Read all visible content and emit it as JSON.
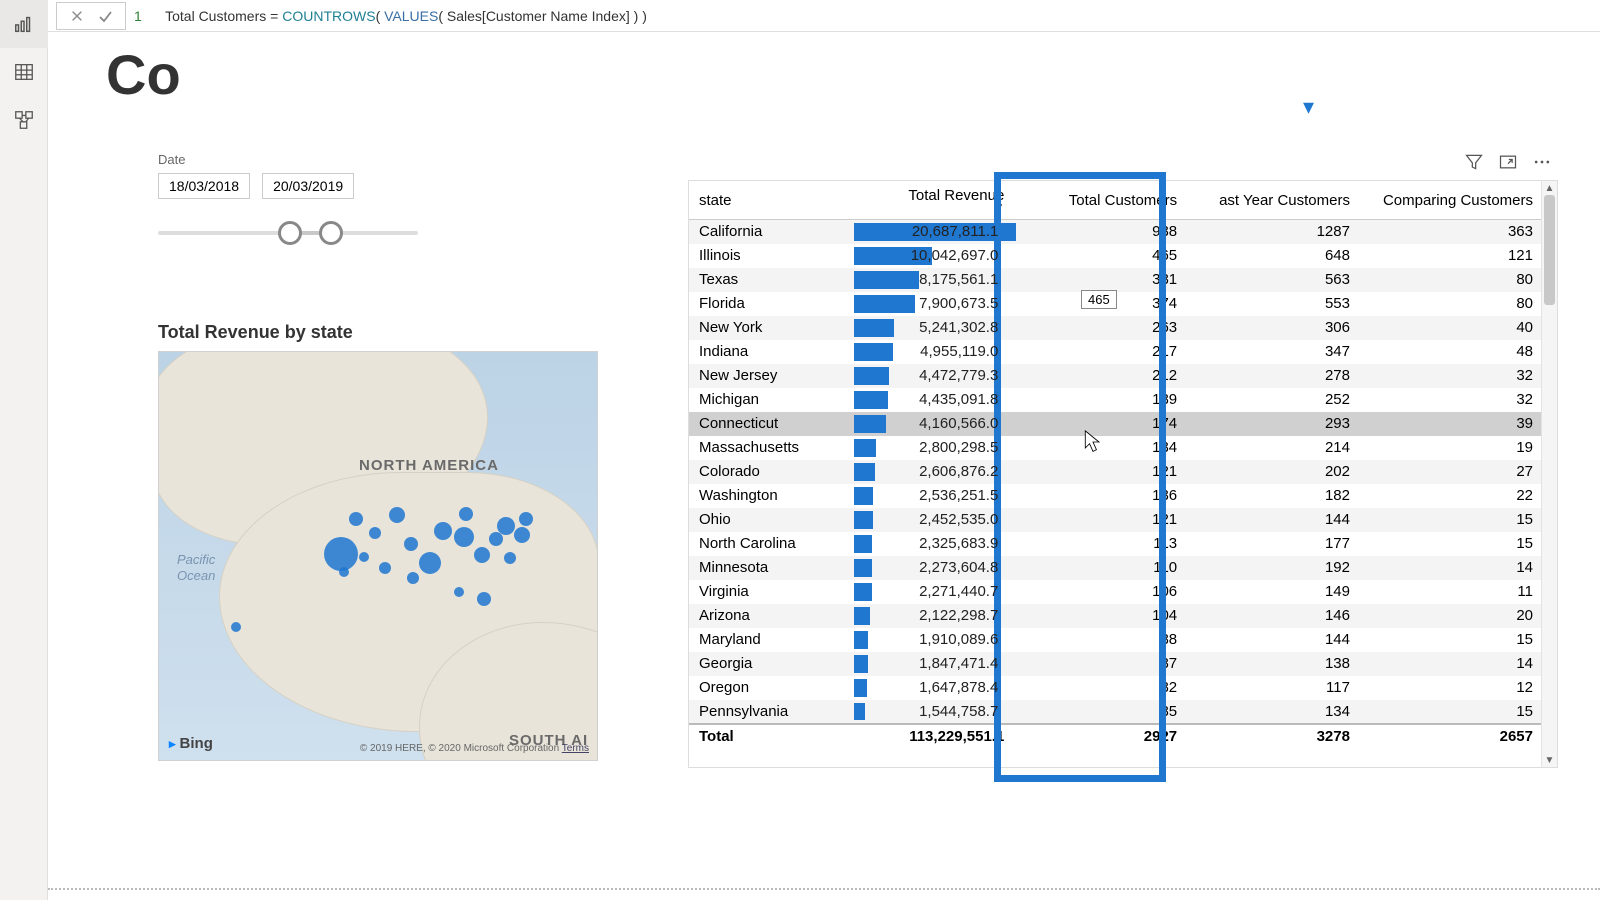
{
  "formula": {
    "line_no": "1",
    "name": "Total Customers",
    "equals": " = ",
    "fn1": "COUNTROWS",
    "open1": "( ",
    "fn2": "VALUES",
    "open2": "( ",
    "col": "Sales[Customer Name Index]",
    "close": " ) )"
  },
  "title_fragment": "Co",
  "slicer": {
    "label": "Date",
    "start": "18/03/2018",
    "end": "20/03/2019"
  },
  "map": {
    "title": "Total Revenue by state",
    "na": "NORTH AMERICA",
    "sa": "SOUTH AI",
    "ocean1": "Pacific",
    "ocean2": "Ocean",
    "bing": "Bing",
    "credits": "© 2019 HERE, © 2020 Microsoft Corporation ",
    "terms": "Terms"
  },
  "table": {
    "headers": {
      "state": "state",
      "rev": "Total Revenue",
      "tc": "Total Customers",
      "ly": "ast Year Customers",
      "cc": "Comparing Customers"
    },
    "rows": [
      {
        "state": "California",
        "rev": "20,687,811.1",
        "bar": 100,
        "tc": "938",
        "ly": "1287",
        "cc": "363"
      },
      {
        "state": "Illinois",
        "rev": "10,042,697.0",
        "bar": 48,
        "tc": "465",
        "ly": "648",
        "cc": "121"
      },
      {
        "state": "Texas",
        "rev": "8,175,561.1",
        "bar": 40,
        "tc": "381",
        "ly": "563",
        "cc": "80"
      },
      {
        "state": "Florida",
        "rev": "7,900,673.5",
        "bar": 38,
        "tc": "374",
        "ly": "553",
        "cc": "80"
      },
      {
        "state": "New York",
        "rev": "5,241,302.8",
        "bar": 25,
        "tc": "263",
        "ly": "306",
        "cc": "40"
      },
      {
        "state": "Indiana",
        "rev": "4,955,119.0",
        "bar": 24,
        "tc": "217",
        "ly": "347",
        "cc": "48"
      },
      {
        "state": "New Jersey",
        "rev": "4,472,779.3",
        "bar": 22,
        "tc": "212",
        "ly": "278",
        "cc": "32"
      },
      {
        "state": "Michigan",
        "rev": "4,435,091.8",
        "bar": 21,
        "tc": "189",
        "ly": "252",
        "cc": "32"
      },
      {
        "state": "Connecticut",
        "rev": "4,160,566.0",
        "bar": 20,
        "tc": "174",
        "ly": "293",
        "cc": "39",
        "hover": true
      },
      {
        "state": "Massachusetts",
        "rev": "2,800,298.5",
        "bar": 14,
        "tc": "134",
        "ly": "214",
        "cc": "19"
      },
      {
        "state": "Colorado",
        "rev": "2,606,876.2",
        "bar": 13,
        "tc": "121",
        "ly": "202",
        "cc": "27"
      },
      {
        "state": "Washington",
        "rev": "2,536,251.5",
        "bar": 12,
        "tc": "136",
        "ly": "182",
        "cc": "22"
      },
      {
        "state": "Ohio",
        "rev": "2,452,535.0",
        "bar": 12,
        "tc": "121",
        "ly": "144",
        "cc": "15"
      },
      {
        "state": "North Carolina",
        "rev": "2,325,683.9",
        "bar": 11,
        "tc": "113",
        "ly": "177",
        "cc": "15"
      },
      {
        "state": "Minnesota",
        "rev": "2,273,604.8",
        "bar": 11,
        "tc": "110",
        "ly": "192",
        "cc": "14"
      },
      {
        "state": "Virginia",
        "rev": "2,271,440.7",
        "bar": 11,
        "tc": "106",
        "ly": "149",
        "cc": "11"
      },
      {
        "state": "Arizona",
        "rev": "2,122,298.7",
        "bar": 10,
        "tc": "104",
        "ly": "146",
        "cc": "20"
      },
      {
        "state": "Maryland",
        "rev": "1,910,089.6",
        "bar": 9,
        "tc": "88",
        "ly": "144",
        "cc": "15"
      },
      {
        "state": "Georgia",
        "rev": "1,847,471.4",
        "bar": 9,
        "tc": "87",
        "ly": "138",
        "cc": "14"
      },
      {
        "state": "Oregon",
        "rev": "1,647,878.4",
        "bar": 8,
        "tc": "82",
        "ly": "117",
        "cc": "12"
      },
      {
        "state": "Pennsylvania",
        "rev": "1,544,758.7",
        "bar": 7,
        "tc": "85",
        "ly": "134",
        "cc": "15"
      }
    ],
    "total": {
      "state": "Total",
      "rev": "113,229,551.1",
      "tc": "2927",
      "ly": "3278",
      "cc": "2657"
    }
  },
  "tooltip": "465",
  "chart_data": {
    "type": "table",
    "title": "Total Revenue by state",
    "columns": [
      "state",
      "Total Revenue",
      "Total Customers",
      "Last Year Customers",
      "Comparing Customers"
    ],
    "bar_column": "Total Revenue",
    "bar_max": 20687811.1,
    "rows": [
      [
        "California",
        20687811.1,
        938,
        1287,
        363
      ],
      [
        "Illinois",
        10042697.0,
        465,
        648,
        121
      ],
      [
        "Texas",
        8175561.1,
        381,
        563,
        80
      ],
      [
        "Florida",
        7900673.5,
        374,
        553,
        80
      ],
      [
        "New York",
        5241302.8,
        263,
        306,
        40
      ],
      [
        "Indiana",
        4955119.0,
        217,
        347,
        48
      ],
      [
        "New Jersey",
        4472779.3,
        212,
        278,
        32
      ],
      [
        "Michigan",
        4435091.8,
        189,
        252,
        32
      ],
      [
        "Connecticut",
        4160566.0,
        174,
        293,
        39
      ],
      [
        "Massachusetts",
        2800298.5,
        134,
        214,
        19
      ],
      [
        "Colorado",
        2606876.2,
        121,
        202,
        27
      ],
      [
        "Washington",
        2536251.5,
        136,
        182,
        22
      ],
      [
        "Ohio",
        2452535.0,
        121,
        144,
        15
      ],
      [
        "North Carolina",
        2325683.9,
        113,
        177,
        15
      ],
      [
        "Minnesota",
        2273604.8,
        110,
        192,
        14
      ],
      [
        "Virginia",
        2271440.7,
        106,
        149,
        11
      ],
      [
        "Arizona",
        2122298.7,
        104,
        146,
        20
      ],
      [
        "Maryland",
        1910089.6,
        88,
        144,
        15
      ],
      [
        "Georgia",
        1847471.4,
        87,
        138,
        14
      ],
      [
        "Oregon",
        1647878.4,
        82,
        117,
        12
      ],
      [
        "Pennsylvania",
        1544758.7,
        85,
        134,
        15
      ]
    ],
    "totals": [
      "Total",
      113229551.1,
      2927,
      3278,
      2657
    ]
  }
}
